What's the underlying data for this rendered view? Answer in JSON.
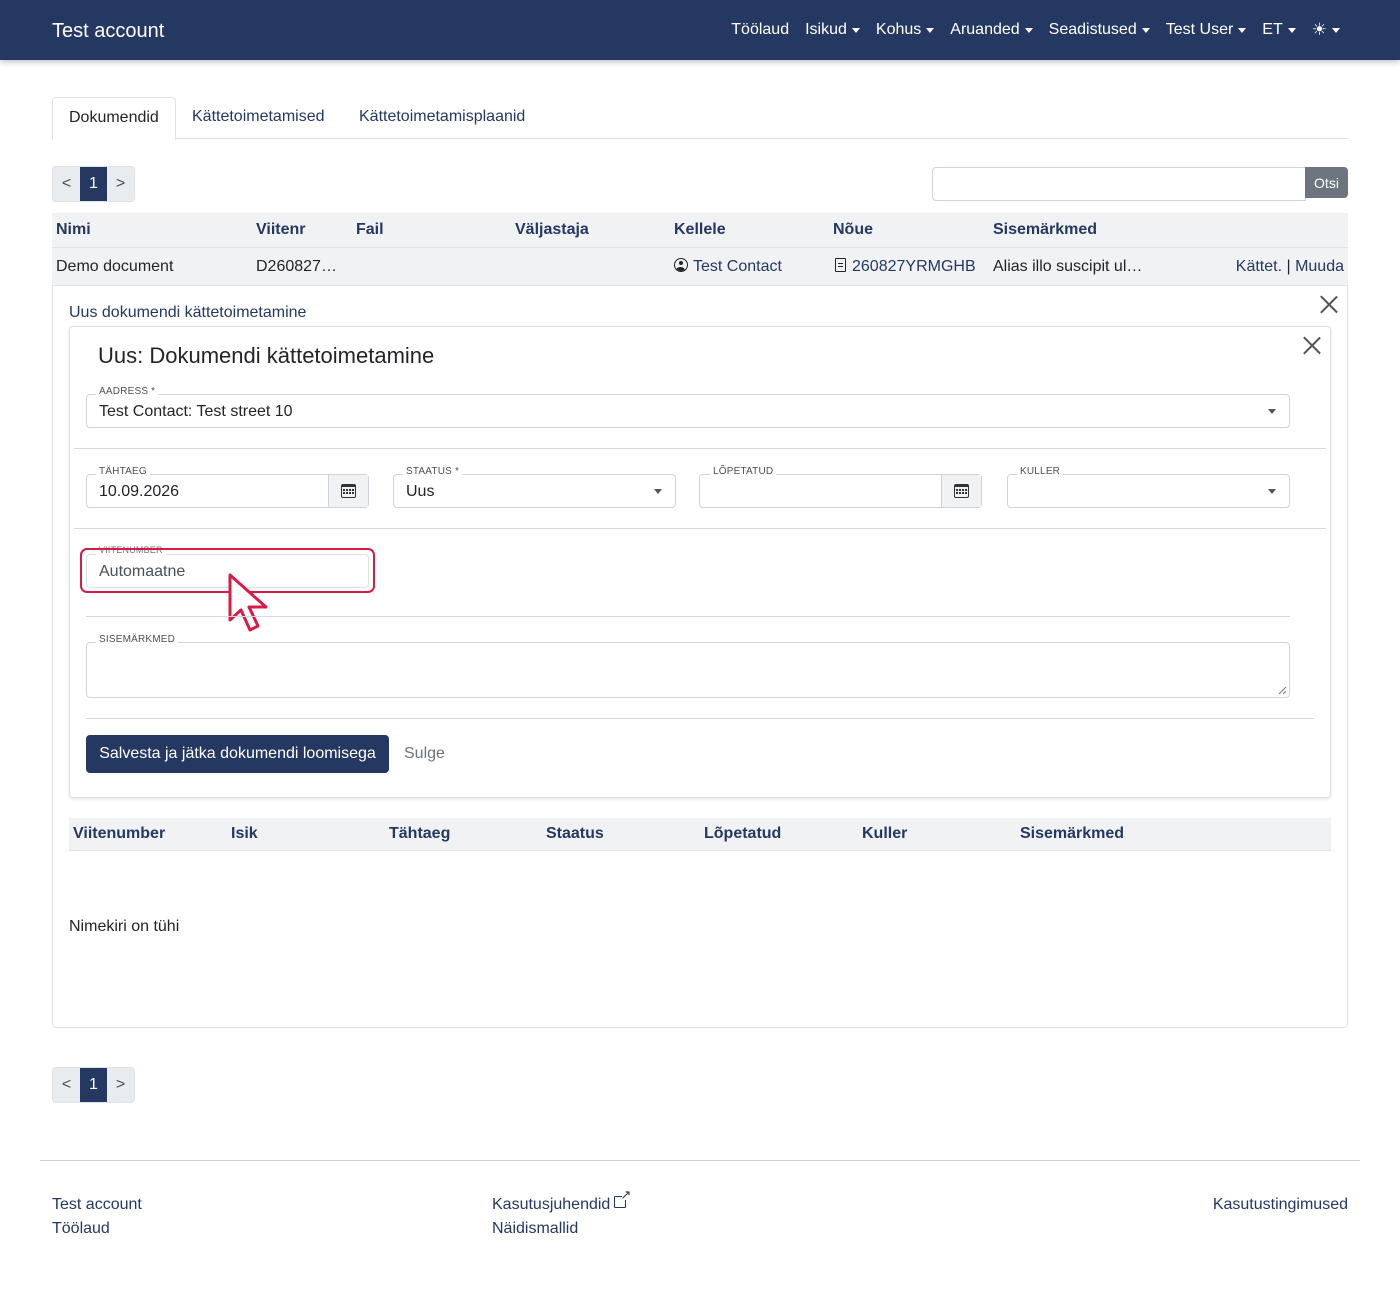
{
  "navbar": {
    "brand": "Test account",
    "items": [
      "Töölaud",
      "Isikud",
      "Kohus",
      "Aruanded",
      "Seadistused",
      "Test User",
      "ET"
    ],
    "theme_icon": "sun-icon"
  },
  "tabs": [
    "Dokumendid",
    "Kättetoimetamised",
    "Kättetoimetamisplaanid"
  ],
  "pager": {
    "prev": "<",
    "current": "1",
    "next": ">"
  },
  "search": {
    "value": "",
    "button": "Otsi"
  },
  "table": {
    "headers": [
      "Nimi",
      "Viitenr",
      "Fail",
      "Väljastaja",
      "Kellele",
      "Nõue",
      "Sisemärkmed"
    ],
    "row": {
      "nimi": "Demo document",
      "viitenr": "D260827…",
      "fail": "",
      "valjastaja": "",
      "kellele": "Test Contact",
      "noue": "260827YRMGHB",
      "sisemarkmed": "Alias illo suscipit ul…",
      "action_deliver": "Kättet.",
      "action_sep": "|",
      "action_edit": "Muuda"
    }
  },
  "panel": {
    "title": "Uus dokumendi kättetoimetamine",
    "form": {
      "title": "Uus: Dokumendi kättetoimetamine",
      "aadress": {
        "label": "Aadress *",
        "value": "Test Contact: Test street 10"
      },
      "tahtaeg": {
        "label": "Tähtaeg",
        "value": "10.09.2026"
      },
      "staatus": {
        "label": "Staatus *",
        "value": "Uus"
      },
      "lopetatud": {
        "label": "Lõpetatud",
        "value": ""
      },
      "kuller": {
        "label": "Kuller",
        "value": ""
      },
      "viitenumber": {
        "label": "Viitenumber",
        "value": "Automaatne"
      },
      "sisemarkmed": {
        "label": "Sisemärkmed",
        "value": ""
      },
      "save_button": "Salvesta ja jätka dokumendi loomisega",
      "close_button": "Sulge"
    },
    "subtable": {
      "headers": [
        "Viitenumber",
        "Isik",
        "Tähtaeg",
        "Staatus",
        "Lõpetatud",
        "Kuller",
        "Sisemärkmed"
      ],
      "empty": "Nimekiri on tühi"
    }
  },
  "footer": {
    "col1": [
      "Test account",
      "Töölaud"
    ],
    "col2": [
      "Kasutusjuhendid",
      "Näidismallid"
    ],
    "col3": [
      "Kasutustingimused"
    ]
  },
  "colors": {
    "primary": "#243862",
    "highlight": "#d81b46",
    "muted": "#6c757d"
  }
}
